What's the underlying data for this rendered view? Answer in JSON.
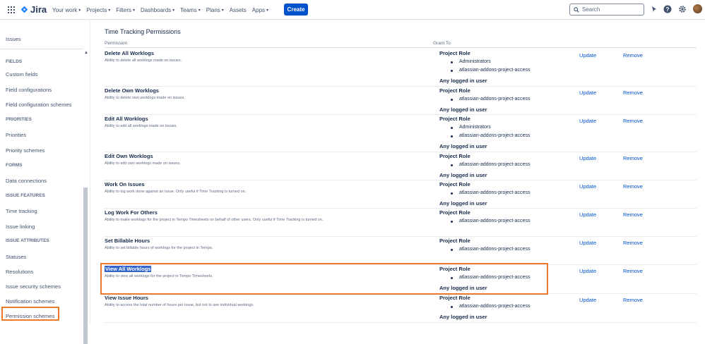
{
  "nav": {
    "product": "Jira",
    "items": [
      "Your work",
      "Projects",
      "Filters",
      "Dashboards",
      "Teams",
      "Plans",
      "Assets",
      "Apps"
    ],
    "dropdown_items": [
      true,
      true,
      true,
      true,
      true,
      true,
      false,
      true
    ],
    "create_label": "Create",
    "search_placeholder": "Search",
    "brand_color": "#0052cc"
  },
  "sidebar": {
    "top_item": "Issues",
    "sections": [
      {
        "heading": "FIELDS",
        "items": [
          "Custom fields",
          "Field configurations",
          "Field configuration schemes"
        ]
      },
      {
        "heading": "PRIORITIES",
        "items": [
          "Priorities",
          "Priority schemes"
        ]
      },
      {
        "heading": "FORMS",
        "items": [
          "Data connections"
        ]
      },
      {
        "heading": "ISSUE FEATURES",
        "items": [
          "Time tracking",
          "Issue linking"
        ]
      },
      {
        "heading": "ISSUE ATTRIBUTES",
        "items": [
          "Statuses",
          "Resolutions",
          "Issue security schemes",
          "Notification schemes",
          "Permission schemes"
        ]
      }
    ],
    "active_item": "Permission schemes"
  },
  "main": {
    "section_title": "Time Tracking Permissions",
    "col_permission": "Permission",
    "col_grant": "Grant To",
    "update_label": "Update",
    "remove_label": "Remove",
    "rows": [
      {
        "name": "Delete All Worklogs",
        "desc": "Ability to delete all worklogs made on issues.",
        "grant_title": "Project Role",
        "roles": [
          "Administrators",
          "atlassian-addons-project-access"
        ],
        "any": "Any logged in user"
      },
      {
        "name": "Delete Own Worklogs",
        "desc": "Ability to delete own worklogs made on issues.",
        "grant_title": "Project Role",
        "roles": [
          "atlassian-addons-project-access"
        ],
        "any": "Any logged in user"
      },
      {
        "name": "Edit All Worklogs",
        "desc": "Ability to edit all worklogs made on issues.",
        "grant_title": "Project Role",
        "roles": [
          "Administrators",
          "atlassian-addons-project-access"
        ],
        "any": "Any logged in user"
      },
      {
        "name": "Edit Own Worklogs",
        "desc": "Ability to edit own worklogs made on issues.",
        "grant_title": "Project Role",
        "roles": [
          "atlassian-addons-project-access"
        ],
        "any": "Any logged in user"
      },
      {
        "name": "Work On Issues",
        "desc": "Ability to log work done against an issue. Only useful if Time Tracking is turned on.",
        "grant_title": "Project Role",
        "roles": [
          "atlassian-addons-project-access"
        ],
        "any": "Any logged in user"
      },
      {
        "name": "Log Work For Others",
        "desc": "Ability to make worklogs for the project in Tempo Timesheets on behalf of other users. Only useful if Time Tracking is turned on.",
        "grant_title": "Project Role",
        "roles": [
          "atlassian-addons-project-access"
        ],
        "any": ""
      },
      {
        "name": "Set Billable Hours",
        "desc": "Ability to set billable hours of worklogs for the project in Tempo.",
        "grant_title": "Project Role",
        "roles": [
          "atlassian-addons-project-access"
        ],
        "any": ""
      },
      {
        "name": "View All Worklogs",
        "desc": "Ability to view all worklogs for the project in Tempo Timesheets.",
        "grant_title": "Project Role",
        "roles": [
          "atlassian-addons-project-access"
        ],
        "any": "Any logged in user",
        "selected": true
      },
      {
        "name": "View Issue Hours",
        "desc": "Ability to access the total number of hours per issue, but not to see individual worklogs.",
        "grant_title": "Project Role",
        "roles": [
          "atlassian-addons-project-access"
        ],
        "any": "Any logged in user"
      }
    ]
  }
}
